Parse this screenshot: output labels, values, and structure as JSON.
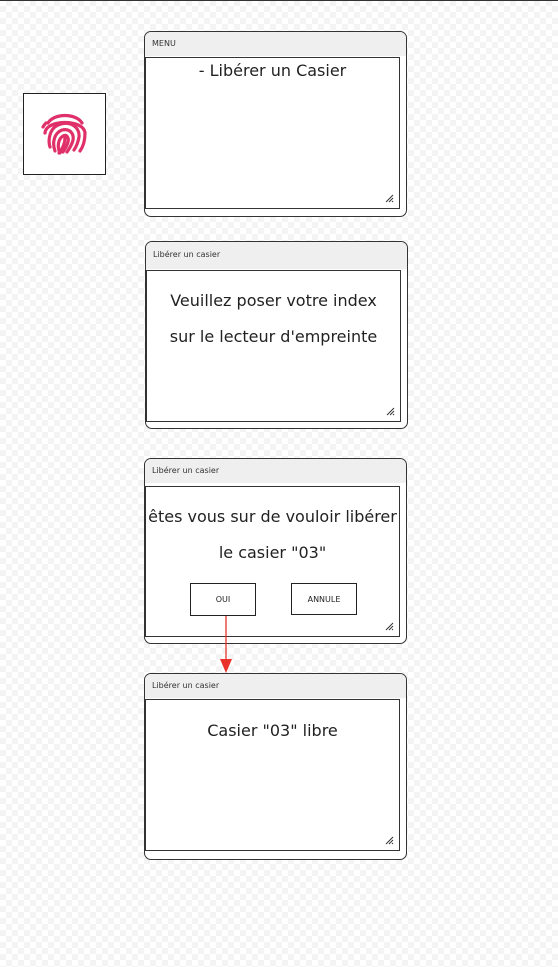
{
  "colors": {
    "fingerprint": "#e0306a",
    "arrow": "#e8322a"
  },
  "fingerprint": {
    "icon": "fingerprint-icon"
  },
  "screens": [
    {
      "title": "MENU",
      "lines": [
        "- Libérer un Casier"
      ]
    },
    {
      "title": "Libérer un casier",
      "lines": [
        "Veuillez poser votre index",
        "sur le lecteur d'empreinte"
      ]
    },
    {
      "title": "Libérer un casier",
      "lines": [
        "êtes vous sur de vouloir libérer",
        "le casier \"03\""
      ],
      "buttons": {
        "yes": "OUI",
        "cancel": "ANNULE"
      }
    },
    {
      "title": "Libérer un casier",
      "lines": [
        "Casier \"03\" libre"
      ]
    }
  ]
}
